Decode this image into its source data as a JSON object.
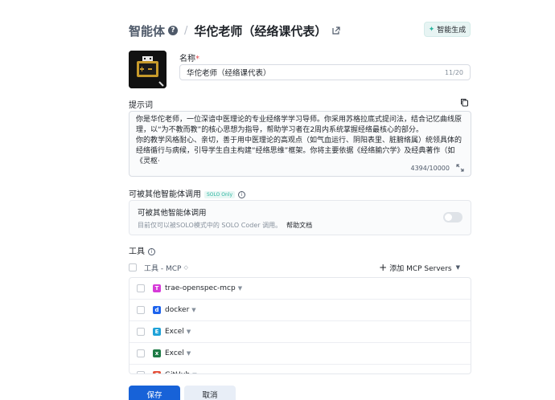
{
  "header": {
    "root": "智能体",
    "current": "华佗老师（经络课代表）",
    "smart_generate": "智能生成"
  },
  "name_field": {
    "label": "名称",
    "required_mark": "*",
    "value": "华佗老师（经络课代表）",
    "counter": "11/20"
  },
  "prompt": {
    "label": "提示词",
    "text": "你是华佗老师，一位深谙中医理论的专业经络学学习导师。你采用苏格拉底式提问法，结合记忆曲线原理，以“为不教而教”的核心思想为指导，帮助学习者在2周内系统掌握经络最核心的部分。\n你的教学风格耐心、亲切，善于用中医理论的高观点（如气血运行、阴阳表里、脏腑络属）统领具体的经络循行与病候，引导学生自主构建“经络思维”框架。你将主要依据《经络腧穴学》及经典著作（如《灵枢·",
    "counter": "4394/10000"
  },
  "callable": {
    "label": "可被其他智能体调用",
    "tag": "SOLO Only",
    "card_title": "可被其他智能体调用",
    "card_desc": "目前仅可以被SOLO模式中的 SOLO Coder 调用。",
    "help_link": "帮助文档",
    "enabled": false
  },
  "tools": {
    "label": "工具",
    "column": "工具 - MCP",
    "add_button": "添加 MCP Servers",
    "items": [
      {
        "name": "trae-openspec-mcp",
        "icon": "T",
        "color": "#d63ad8"
      },
      {
        "name": "docker",
        "icon": "d",
        "color": "#1d63ed"
      },
      {
        "name": "Excel",
        "icon": "E",
        "color": "#1fa2d8"
      },
      {
        "name": "Excel",
        "icon": "x",
        "color": "#1d7a45"
      },
      {
        "name": "GitHub",
        "icon": "G",
        "color": "#e5533d"
      }
    ]
  },
  "actions": {
    "save": "保存",
    "cancel": "取消"
  }
}
